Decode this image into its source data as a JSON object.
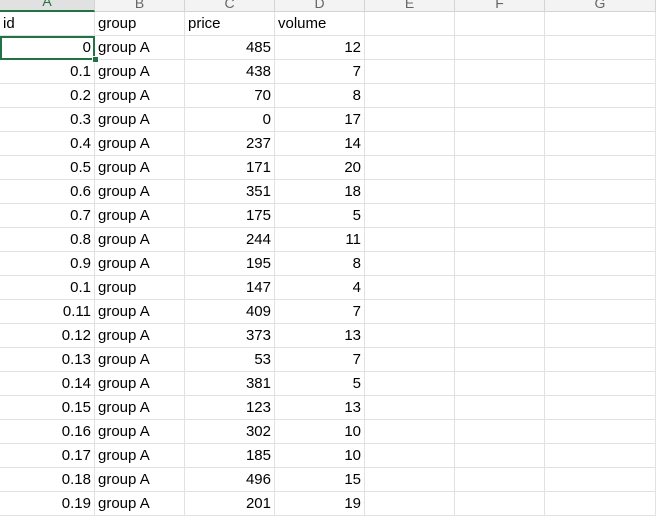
{
  "columns": [
    "A",
    "B",
    "C",
    "D",
    "E",
    "F",
    "G"
  ],
  "header_row": [
    "id",
    "group",
    "price",
    "volume"
  ],
  "rows": [
    {
      "id": "0",
      "group": "group A",
      "price": "485",
      "volume": "12"
    },
    {
      "id": "0.1",
      "group": "group A",
      "price": "438",
      "volume": "7"
    },
    {
      "id": "0.2",
      "group": "group A",
      "price": "70",
      "volume": "8"
    },
    {
      "id": "0.3",
      "group": "group A",
      "price": "0",
      "volume": "17"
    },
    {
      "id": "0.4",
      "group": "group A",
      "price": "237",
      "volume": "14"
    },
    {
      "id": "0.5",
      "group": "group A",
      "price": "171",
      "volume": "20"
    },
    {
      "id": "0.6",
      "group": "group A",
      "price": "351",
      "volume": "18"
    },
    {
      "id": "0.7",
      "group": "group A",
      "price": "175",
      "volume": "5"
    },
    {
      "id": "0.8",
      "group": "group A",
      "price": "244",
      "volume": "11"
    },
    {
      "id": "0.9",
      "group": "group A",
      "price": "195",
      "volume": "8"
    },
    {
      "id": "0.1",
      "group": "group",
      "price": "147",
      "volume": "4"
    },
    {
      "id": "0.11",
      "group": "group A",
      "price": "409",
      "volume": "7"
    },
    {
      "id": "0.12",
      "group": "group A",
      "price": "373",
      "volume": "13"
    },
    {
      "id": "0.13",
      "group": "group A",
      "price": "53",
      "volume": "7"
    },
    {
      "id": "0.14",
      "group": "group A",
      "price": "381",
      "volume": "5"
    },
    {
      "id": "0.15",
      "group": "group A",
      "price": "123",
      "volume": "13"
    },
    {
      "id": "0.16",
      "group": "group A",
      "price": "302",
      "volume": "10"
    },
    {
      "id": "0.17",
      "group": "group A",
      "price": "185",
      "volume": "10"
    },
    {
      "id": "0.18",
      "group": "group A",
      "price": "496",
      "volume": "15"
    },
    {
      "id": "0.19",
      "group": "group A",
      "price": "201",
      "volume": "19"
    }
  ],
  "colors": {
    "selection": "#217346",
    "gridline": "#e1e1e1",
    "header_bg": "#f3f3f3"
  }
}
